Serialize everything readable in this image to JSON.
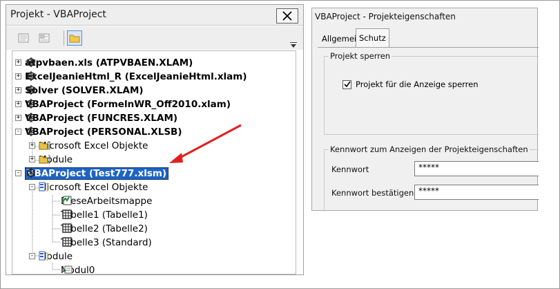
{
  "project_explorer": {
    "title": "Projekt - VBAProject",
    "toolbar": {
      "view_code": "view-code-icon",
      "view_object": "view-object-icon",
      "toggle_folders": "folder-icon"
    },
    "tree": [
      {
        "label": "atpvbaen.xls (ATPVBAEN.XLAM)",
        "bold": true
      },
      {
        "label": "ExcelJeanieHtml_R (ExcelJeanieHtml.xlam)",
        "bold": true
      },
      {
        "label": "Solver (SOLVER.XLAM)",
        "bold": true
      },
      {
        "label": "VBAProject (FormelnWR_Off2010.xlam)",
        "bold": true
      },
      {
        "label": "VBAProject (FUNCRES.XLAM)",
        "bold": true
      },
      {
        "label": "VBAProject (PERSONAL.XLSB)",
        "bold": true
      },
      {
        "label": "Microsoft Excel Objekte"
      },
      {
        "label": "Module"
      },
      {
        "label": "VBAProject (Test777.xlsm)",
        "bold": true,
        "selected": true
      },
      {
        "label": "Microsoft Excel Objekte"
      },
      {
        "label": "DieseArbeitsmappe"
      },
      {
        "label": "Tabelle1 (Tabelle1)"
      },
      {
        "label": "Tabelle2 (Tabelle2)"
      },
      {
        "label": "Tabelle3 (Standard)"
      },
      {
        "label": "Module"
      },
      {
        "label": "Modul0"
      }
    ],
    "annotation_arrow_color": "#e02020",
    "selection_color": "#1f64c4"
  },
  "properties_dialog": {
    "title": "VBAProject - Projekteigenschaften",
    "tabs": [
      {
        "label": "Allgemein",
        "active": false
      },
      {
        "label": "Schutz",
        "active": true
      }
    ],
    "lock_group": {
      "legend": "Projekt sperren",
      "checkbox_label": "Projekt für die Anzeige sperren",
      "checked": true
    },
    "password_group": {
      "legend": "Kennwort zum Anzeigen der Projekteigenschaften",
      "password_label": "Kennwort",
      "password_value": "*****",
      "confirm_label": "Kennwort bestätigen",
      "confirm_value": "*****"
    }
  }
}
